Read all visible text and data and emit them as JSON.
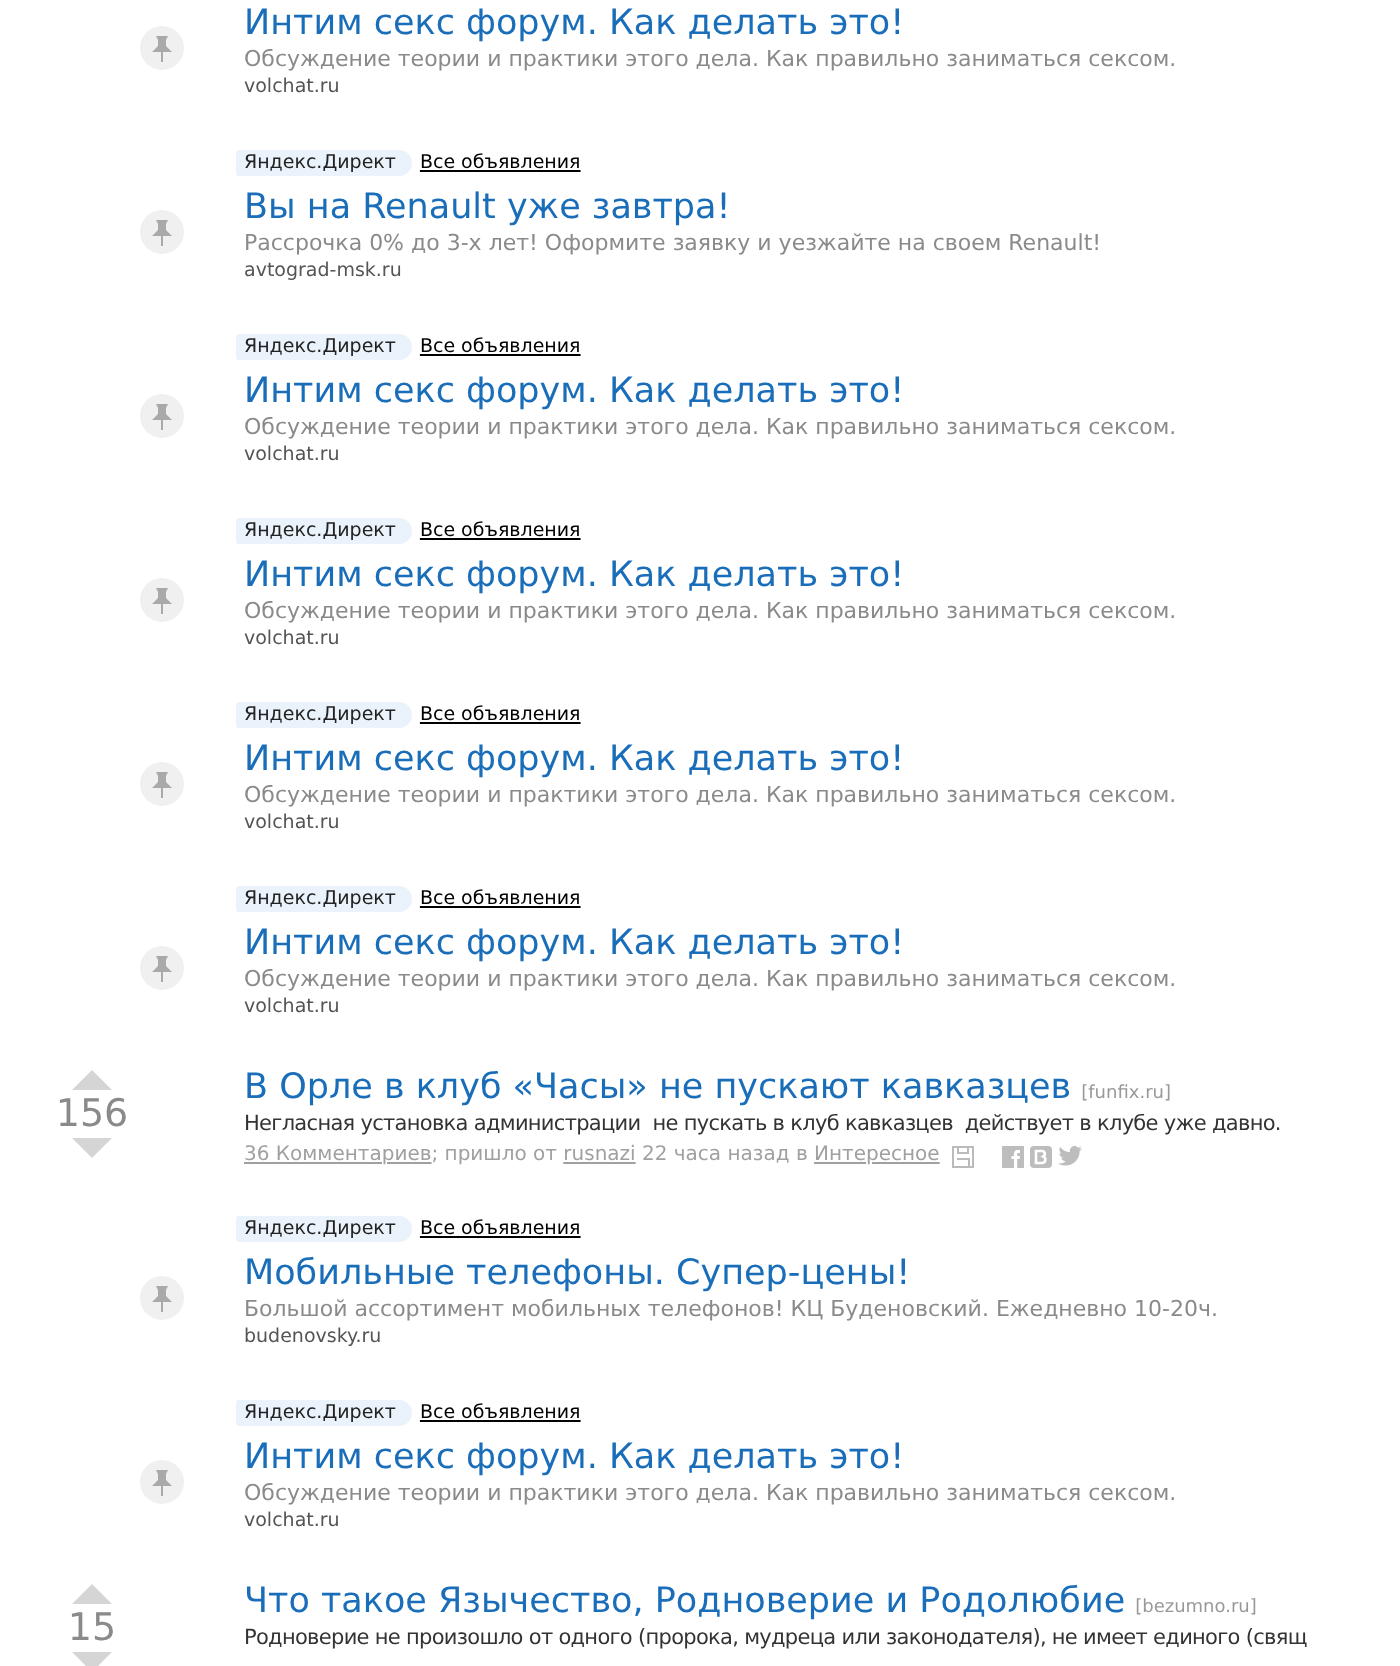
{
  "items": [
    {
      "kind": "ad",
      "title": "Интим секс форум. Как делать это!",
      "text": "Обсуждение теории и практики этого дела. Как правильно заниматься сексом.",
      "domain": "volchat.ru"
    },
    {
      "kind": "ad",
      "badge": "Яндекс.Директ",
      "link": "Все объявления",
      "title": "Вы на Renault уже завтра!",
      "text": "Рассрочка 0% до 3-х лет! Оформите заявку и уезжайте на своем Renault!",
      "domain": "avtograd-msk.ru"
    },
    {
      "kind": "ad",
      "badge": "Яндекс.Директ",
      "link": "Все объявления",
      "title": "Интим секс форум. Как делать это!",
      "text": "Обсуждение теории и практики этого дела. Как правильно заниматься сексом.",
      "domain": "volchat.ru"
    },
    {
      "kind": "ad",
      "badge": "Яндекс.Директ",
      "link": "Все объявления",
      "title": "Интим секс форум. Как делать это!",
      "text": "Обсуждение теории и практики этого дела. Как правильно заниматься сексом.",
      "domain": "volchat.ru"
    },
    {
      "kind": "ad",
      "badge": "Яндекс.Директ",
      "link": "Все объявления",
      "title": "Интим секс форум. Как делать это!",
      "text": "Обсуждение теории и практики этого дела. Как правильно заниматься сексом.",
      "domain": "volchat.ru"
    },
    {
      "kind": "ad",
      "badge": "Яндекс.Директ",
      "link": "Все объявления",
      "title": "Интим секс форум. Как делать это!",
      "text": "Обсуждение теории и практики этого дела. Как правильно заниматься сексом.",
      "domain": "volchat.ru"
    },
    {
      "kind": "story",
      "score": "156",
      "title": "В Орле в клуб «Часы» не пускают кавказцев",
      "source": "[funfix.ru]",
      "text": "Негласная установка администрации  не пускать в клуб кавказцев  действует в клубе уже давно.",
      "meta": {
        "comments": "36 Комментариев",
        "from": "; пришло от",
        "user": "rusnazi",
        "time": "22 часа назад в",
        "category": "Интересное"
      }
    },
    {
      "kind": "ad",
      "badge": "Яндекс.Директ",
      "link": "Все объявления",
      "title": "Мобильные телефоны. Супер-цены!",
      "text": "Большой ассортимент мобильных телефонов! КЦ Буденовский. Ежедневно 10-20ч.",
      "domain": "budenovsky.ru"
    },
    {
      "kind": "ad",
      "badge": "Яндекс.Директ",
      "link": "Все объявления",
      "title": "Интим секс форум. Как делать это!",
      "text": "Обсуждение теории и практики этого дела. Как правильно заниматься сексом.",
      "domain": "volchat.ru"
    },
    {
      "kind": "story",
      "score": "15",
      "title": "Что такое Язычество, Родноверие и Родолюбие",
      "source": "[bezumno.ru]",
      "text": "Родноверие не произошло от одного (пророка, мудреца или законодателя), не имеет единого (свящ"
    }
  ]
}
